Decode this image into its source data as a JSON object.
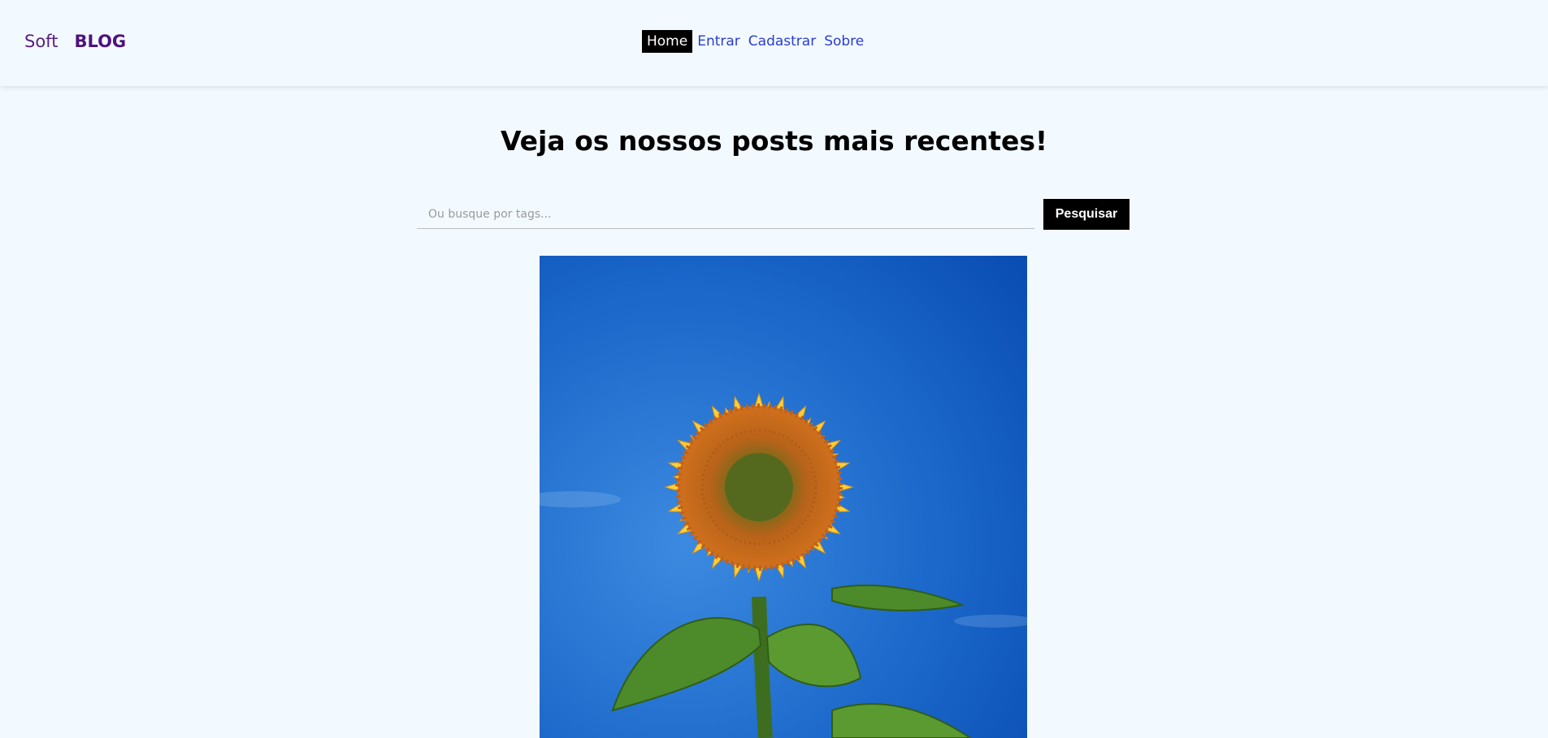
{
  "brand": {
    "light": "Soft",
    "bold": "BLOG"
  },
  "nav": {
    "items": [
      {
        "label": "Home",
        "active": true
      },
      {
        "label": "Entrar",
        "active": false
      },
      {
        "label": "Cadastrar",
        "active": false
      },
      {
        "label": "Sobre",
        "active": false
      }
    ]
  },
  "main": {
    "title": "Veja os nossos posts mais recentes!",
    "search": {
      "placeholder": "Ou busque por tags...",
      "value": "",
      "button_label": "Pesquisar"
    },
    "post": {
      "image_subject": "sunflower against blue sky"
    }
  },
  "colors": {
    "page_background": "#f3faff",
    "brand": "#5b1e86",
    "nav_link": "#2a3bd6",
    "nav_active_bg": "#000000",
    "button_bg": "#000000"
  }
}
